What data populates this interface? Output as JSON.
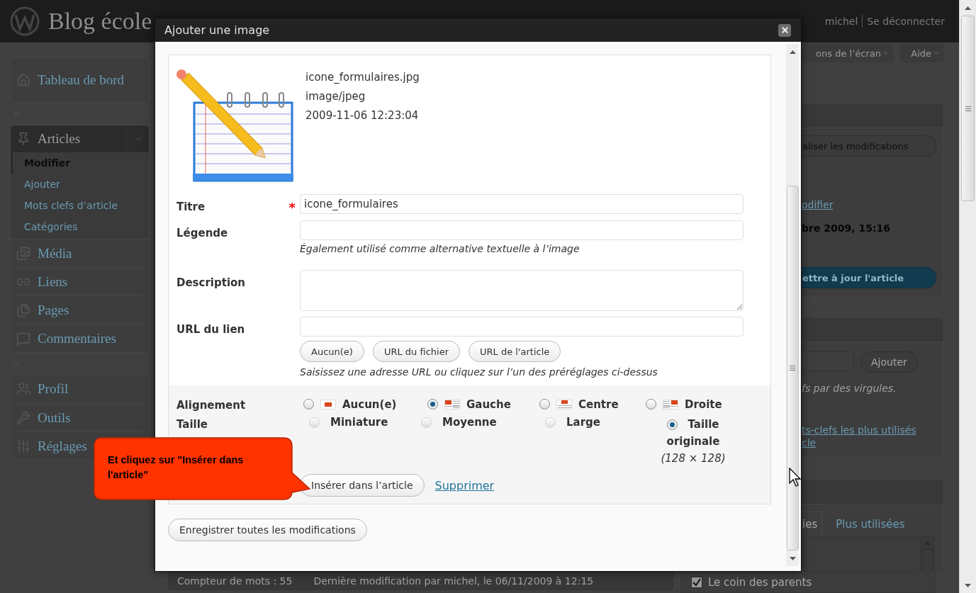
{
  "header": {
    "site_title": "Blog école",
    "user": "michel",
    "logout": "Se déconnecter"
  },
  "sidebar": {
    "sections": [
      {
        "items": [
          {
            "label": "Tableau de bord"
          }
        ]
      },
      {
        "items": [
          {
            "label": "Articles",
            "expanded": true,
            "children": [
              {
                "label": "Modifier",
                "selected": true
              },
              {
                "label": "Ajouter",
                "selected": false
              },
              {
                "label": "Mots clefs d’article",
                "selected": false
              },
              {
                "label": "Catégories",
                "selected": false
              }
            ]
          },
          {
            "label": "Média"
          },
          {
            "label": "Liens"
          },
          {
            "label": "Pages"
          },
          {
            "label": "Commentaires"
          }
        ]
      },
      {
        "items": [
          {
            "label": "Profil"
          },
          {
            "label": "Outils"
          },
          {
            "label": "Réglages"
          }
        ]
      }
    ]
  },
  "right_column": {
    "screen_options": "ons de l’écran",
    "help": "Aide",
    "publish": {
      "save_button": "aliser les modifications",
      "edit_link": "odifier",
      "date": "bre 2009, 15:16",
      "update_button": "ettre à jour l'article"
    },
    "tags": {
      "add_button": "Ajouter",
      "hint": "fs par des virgules.",
      "link_lines": [
        "ts-clefs les plus utilisés",
        "cle"
      ]
    },
    "categories": {
      "tabs": [
        {
          "label": "ies",
          "selected": true
        },
        {
          "label": "Plus utilisées",
          "selected": false
        }
      ],
      "items": [
        {
          "label": "Le coin des parents",
          "checked": true
        }
      ]
    }
  },
  "status_bar": {
    "word_count": "Compteur de mots : 55",
    "last_modified": "Dernière modification par michel, le 06/11/2009 à 12:15"
  },
  "modal": {
    "title": "Ajouter une image",
    "file": {
      "name": "icone_formulaires.jpg",
      "type": "image/jpeg",
      "date": "2009-11-06 12:23:04"
    },
    "fields": [
      {
        "kind": "input",
        "label": "Titre",
        "required_mark": "*",
        "value": "icone_formulaires"
      },
      {
        "kind": "input",
        "label": "Légende",
        "hint": "Également utilisé comme alternative textuelle à l’image"
      },
      {
        "kind": "textarea",
        "label": "Description"
      },
      {
        "kind": "url",
        "label": "URL du lien",
        "buttons": [
          "Aucun(e)",
          "URL du fichier",
          "URL de l'article"
        ],
        "hint": "Saisissez une adresse URL ou cliquez sur l’un des préréglages ci-dessus"
      }
    ],
    "alignment": {
      "label": "Alignement",
      "options": [
        {
          "label": "Aucun(e)",
          "selected": false
        },
        {
          "label": "Gauche",
          "selected": true
        },
        {
          "label": "Centre",
          "selected": false
        },
        {
          "label": "Droite",
          "selected": false
        }
      ]
    },
    "size": {
      "label": "Taille",
      "options": [
        {
          "label": "Miniature",
          "selected": false,
          "disabled": true
        },
        {
          "label": "Moyenne",
          "selected": false,
          "disabled": true
        },
        {
          "label": "Large",
          "selected": false,
          "disabled": true
        },
        {
          "label": "Taille originale",
          "selected": true,
          "disabled": false,
          "dimensions": "(128 × 128)"
        }
      ]
    },
    "insert_button": "Insérer dans l’article",
    "delete_link": "Supprimer",
    "save_all_button": "Enregistrer toutes les modifications"
  },
  "callout": {
    "text": "Et cliquez sur \"Insérer dans l'article\""
  }
}
